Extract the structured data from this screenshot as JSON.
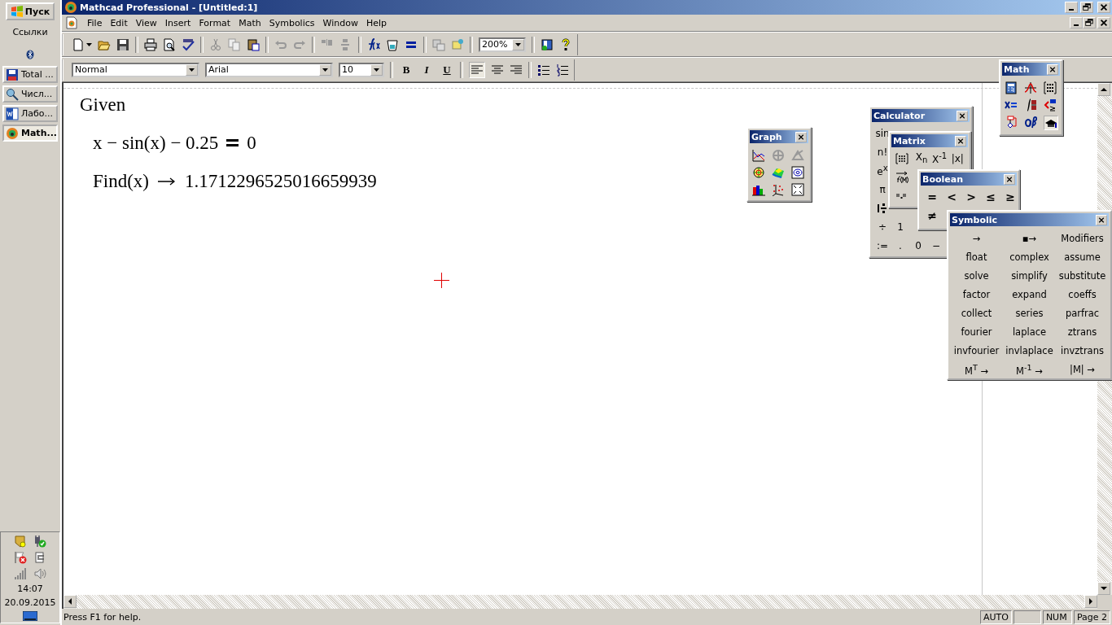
{
  "taskbar": {
    "start_button": "Пуск",
    "links_label": "Ссылки",
    "tasks": [
      {
        "label": "Total ...",
        "selected": false
      },
      {
        "label": "Числ...",
        "selected": false
      },
      {
        "label": "Лабо...",
        "selected": false
      },
      {
        "label": "Math...",
        "selected": true
      }
    ],
    "clock": {
      "time": "14:07",
      "date": "20.09.2015"
    }
  },
  "window": {
    "title": "Mathcad Professional - [Untitled:1]"
  },
  "menu": [
    "File",
    "Edit",
    "View",
    "Insert",
    "Format",
    "Math",
    "Symbolics",
    "Window",
    "Help"
  ],
  "toolbar": {
    "zoom": "200%"
  },
  "format_bar": {
    "style": "Normal",
    "font": "Arial",
    "size": "10",
    "bold": "B",
    "italic": "I",
    "underline": "U"
  },
  "document": {
    "lines": [
      {
        "kind": "text",
        "text": "Given"
      },
      {
        "kind": "equation",
        "lhs": "x − sin(x) − 0.25",
        "rhs": "0"
      },
      {
        "kind": "symbolic",
        "lhs": "Find(x)",
        "result": "1.1712296525016659939"
      }
    ]
  },
  "palettes": {
    "graph": {
      "title": "Graph"
    },
    "math": {
      "title": "Math"
    },
    "calculator": {
      "title": "Calculator",
      "rows": [
        [
          "sin"
        ],
        [
          "n!"
        ],
        [
          "e$^{x}$"
        ],
        [
          "π"
        ],
        [
          {
            "kind": "mixed-fraction"
          }
        ],
        [
          "÷",
          "1"
        ],
        [
          ":=",
          ".",
          "0",
          "−"
        ]
      ]
    },
    "matrix": {
      "title": "Matrix",
      "rows": [
        [
          {
            "kind": "matrix"
          },
          "X$_{n}$",
          "X$^{-1}$",
          "|x|"
        ],
        [
          {
            "kind": "vectorize"
          }
        ],
        [
          {
            "kind": "dot-product"
          }
        ]
      ]
    },
    "boolean": {
      "title": "Boolean",
      "rows": [
        [
          "=",
          "<",
          ">",
          "≤",
          "≥"
        ],
        [
          "≠"
        ]
      ]
    },
    "symbolic": {
      "title": "Symbolic",
      "items": [
        "→",
        "▪→",
        "Modifiers",
        "float",
        "complex",
        "assume",
        "solve",
        "simplify",
        "substitute",
        "factor",
        "expand",
        "coeffs",
        "collect",
        "series",
        "parfrac",
        "fourier",
        "laplace",
        "ztrans",
        "invfourier",
        "invlaplace",
        "invztrans",
        "M$^{T}$ →",
        "M$^{-1}$ →",
        "|M| →"
      ]
    }
  },
  "status_bar": {
    "help": "Press F1 for help.",
    "panels": [
      "AUTO",
      "NUM",
      "Page 2"
    ]
  }
}
